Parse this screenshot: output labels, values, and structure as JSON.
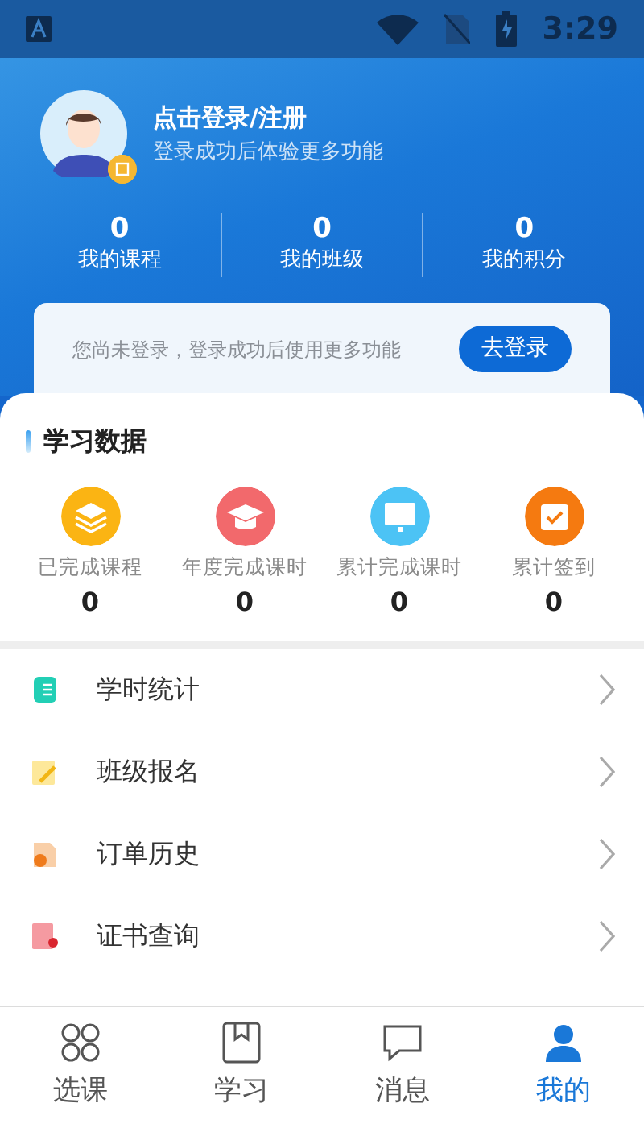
{
  "status_bar": {
    "time": "3:29"
  },
  "profile": {
    "title": "点击登录/注册",
    "subtitle": "登录成功后体验更多功能"
  },
  "stats": [
    {
      "value": "0",
      "label": "我的课程"
    },
    {
      "value": "0",
      "label": "我的班级"
    },
    {
      "value": "0",
      "label": "我的积分"
    }
  ],
  "login_prompt": {
    "text": "您尚未登录，登录成功后使用更多功能",
    "button": "去登录"
  },
  "study_data": {
    "title": "学习数据",
    "items": [
      {
        "kind": "layers",
        "color": "#fbb413",
        "label": "已完成课程",
        "value": "0"
      },
      {
        "kind": "cap",
        "color": "#f2696c",
        "label": "年度完成课时",
        "value": "0"
      },
      {
        "kind": "monitor",
        "color": "#4cc3f5",
        "label": "累计完成课时",
        "value": "0"
      },
      {
        "kind": "calendar",
        "color": "#f57a10",
        "label": "累计签到",
        "value": "0"
      }
    ]
  },
  "menu": [
    {
      "kind": "notebook",
      "label": "学时统计"
    },
    {
      "kind": "pencil",
      "label": "班级报名"
    },
    {
      "kind": "order",
      "label": "订单历史"
    },
    {
      "kind": "certificate",
      "label": "证书查询"
    }
  ],
  "tabs": [
    {
      "kind": "grid",
      "label": "选课",
      "selected": false
    },
    {
      "kind": "book",
      "label": "学习",
      "selected": false
    },
    {
      "kind": "chat",
      "label": "消息",
      "selected": false
    },
    {
      "kind": "person",
      "label": "我的",
      "selected": true
    }
  ]
}
